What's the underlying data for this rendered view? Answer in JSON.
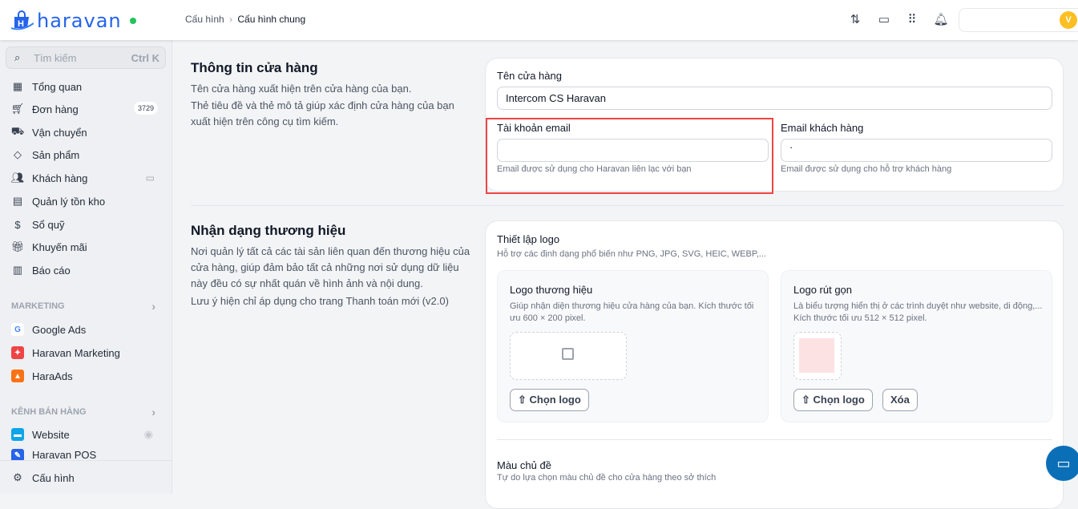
{
  "header": {
    "brand": "haravan",
    "breadcrumb_parent": "Cấu hình",
    "breadcrumb_sep": "›",
    "breadcrumb_current": "Cấu hình chung",
    "avatar_initial": "V"
  },
  "sidebar": {
    "search_placeholder": "Tìm kiếm",
    "search_shortcut": "Ctrl K",
    "items": [
      {
        "label": "Tổng quan",
        "icon": "dashboard-icon"
      },
      {
        "label": "Đơn hàng",
        "badge": "3729",
        "icon": "cart-icon"
      },
      {
        "label": "Vận chuyển",
        "icon": "truck-icon"
      },
      {
        "label": "Sản phẩm",
        "icon": "tag-icon"
      },
      {
        "label": "Khách hàng",
        "icon": "users-icon"
      },
      {
        "label": "Quản lý tồn kho",
        "icon": "archive-icon"
      },
      {
        "label": "Sổ quỹ",
        "icon": "dollar-icon"
      },
      {
        "label": "Khuyến mãi",
        "icon": "gift-icon"
      },
      {
        "label": "Báo cáo",
        "icon": "report-icon"
      }
    ],
    "marketing_title": "MARKETING",
    "marketing": [
      {
        "label": "Google Ads"
      },
      {
        "label": "Haravan Marketing"
      },
      {
        "label": "HaraAds"
      }
    ],
    "channels_title": "KÊNH BÁN HÀNG",
    "channels": [
      {
        "label": "Website"
      },
      {
        "label": "Haravan POS"
      }
    ],
    "settings": "Cấu hình"
  },
  "store_info": {
    "title": "Thông tin cửa hàng",
    "desc1": "Tên cửa hàng xuất hiện trên cửa hàng của bạn.",
    "desc2": "Thẻ tiêu đề và thẻ mô tả giúp xác định cửa hàng của bạn xuất hiện trên công cụ tìm kiếm.",
    "name_label": "Tên cửa hàng",
    "name_value": "Intercom CS Haravan",
    "email_label": "Tài khoản email",
    "email_value": "",
    "email_hint": "Email được sử dụng cho Haravan liên lạc với bạn",
    "cust_email_label": "Email khách hàng",
    "cust_email_value": "·",
    "cust_email_hint": "Email được sử dụng cho hỗ trợ khách hàng"
  },
  "brand": {
    "title": "Nhận dạng thương hiệu",
    "desc": "Nơi quản lý tất cả các tài sản liên quan đến thương hiệu của cửa hàng, giúp đảm bảo tất cả những nơi sử dụng dữ liệu này đều có sự nhất quán về hình ảnh và nội dung.",
    "note": "Lưu ý hiện chỉ áp dụng cho trang Thanh toán mới (v2.0)",
    "logo_title": "Thiết lập logo",
    "logo_hint": "Hỗ trợ các định dạng phổ biến như PNG, JPG, SVG, HEIC, WEBP,...",
    "main_logo_title": "Logo thương hiệu",
    "main_logo_desc": "Giúp nhận diện thương hiệu cửa hàng của bạn. Kích thước tối ưu 600 × 200 pixel.",
    "short_logo_title": "Logo rút gọn",
    "short_logo_desc": "Là biểu tượng hiển thị ở các trình duyệt như website, di động,... Kích thước tối ưu 512 × 512 pixel.",
    "choose_logo": "Chọn logo",
    "delete": "Xóa",
    "theme_title": "Màu chủ đề",
    "theme_hint": "Tự do lựa chọn màu chủ đề cho cửa hàng theo sở thích"
  }
}
